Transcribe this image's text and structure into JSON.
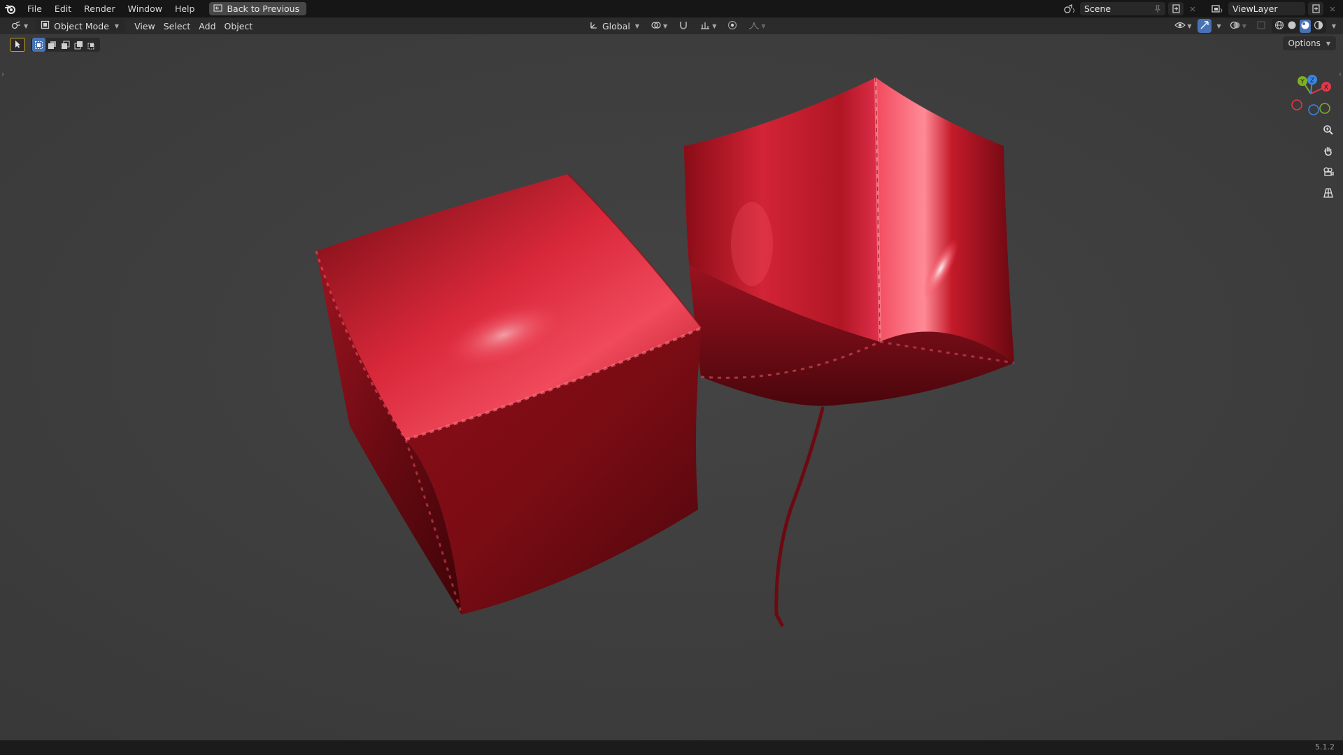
{
  "menu": {
    "items": [
      "File",
      "Edit",
      "Render",
      "Window",
      "Help"
    ],
    "back_button": "Back to Previous"
  },
  "top_right": {
    "scene": "Scene",
    "view_layer": "ViewLayer"
  },
  "viewport_header": {
    "mode": "Object Mode",
    "menus": [
      "View",
      "Select",
      "Add",
      "Object"
    ],
    "transform_orientation": "Global"
  },
  "viewport": {
    "options_label": "Options",
    "gizmo_axes": {
      "x": "X",
      "y": "Y",
      "z": "Z"
    }
  },
  "status": {
    "version": "5.1.2"
  },
  "colors": {
    "accent": "#4772b3",
    "axis_x": "#e1384c",
    "axis_y": "#7fb021",
    "axis_z": "#3a86e6",
    "balloon_red": "#c0141e"
  }
}
